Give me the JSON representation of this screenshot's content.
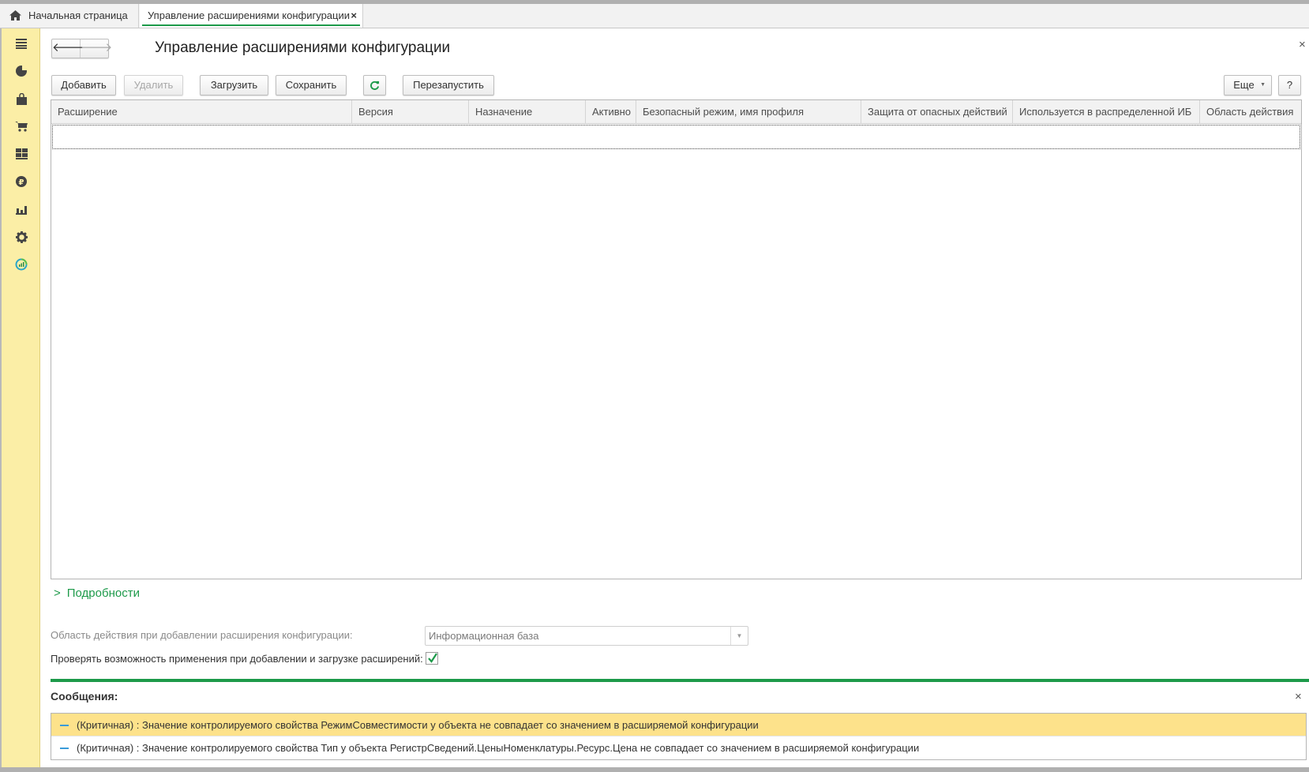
{
  "tabs": {
    "home": "Начальная страница",
    "active": "Управление расширениями конфигурации",
    "close": "×"
  },
  "sidebar": {
    "items": [
      "menu-icon",
      "dashboard-icon",
      "purchases-icon",
      "sales-icon",
      "warehouse-icon",
      "finance-icon",
      "reports-icon",
      "settings-icon",
      "analytics-icon"
    ]
  },
  "page": {
    "title": "Управление расширениями конфигурации",
    "close": "×"
  },
  "toolbar": {
    "add": "Добавить",
    "delete": "Удалить",
    "load": "Загрузить",
    "save": "Сохранить",
    "restart": "Перезапустить",
    "more": "Еще",
    "help": "?"
  },
  "table": {
    "columns": [
      "Расширение",
      "Версия",
      "Назначение",
      "Активно",
      "Безопасный режим, имя профиля",
      "Защита от опасных действий",
      "Используется в распределенной ИБ",
      "Область действия"
    ],
    "rows": []
  },
  "details": {
    "label": "Подробности"
  },
  "settings": {
    "scope_label": "Область действия при добавлении расширения конфигурации:",
    "scope_value": "Информационная база",
    "check_label": "Проверять возможность применения при добавлении и загрузке расширений:",
    "check_value": true
  },
  "messages": {
    "title": "Сообщения:",
    "close": "×",
    "items": [
      "(Критичная) : Значение контролируемого свойства РежимСовместимости у объекта  не совпадает со значением в расширяемой конфигурации",
      "(Критичная) : Значение контролируемого свойства Тип у объекта РегистрСведений.ЦеныНоменклатуры.Ресурс.Цена не совпадает со значением в расширяемой конфигурации"
    ]
  },
  "colors": {
    "accent": "#1d9a4a",
    "sidebar": "#fbeea6",
    "highlight": "#fde28b"
  }
}
